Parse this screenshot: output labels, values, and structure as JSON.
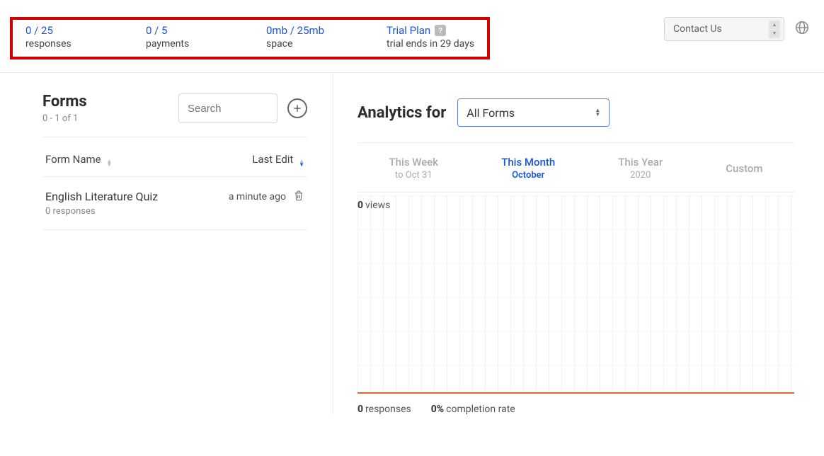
{
  "topbar": {
    "stats": {
      "responses": {
        "value": "0 / 25",
        "label": "responses"
      },
      "payments": {
        "value": "0 / 5",
        "label": "payments"
      },
      "space": {
        "value": "0mb / 25mb",
        "label": "space"
      },
      "plan": {
        "value": "Trial Plan",
        "help": "?",
        "label": "trial ends in 29 days"
      }
    },
    "contact_label": "Contact Us"
  },
  "sidebar": {
    "title": "Forms",
    "range": "0 - 1 of 1",
    "search_placeholder": "Search",
    "col_name": "Form Name",
    "col_edit": "Last Edit",
    "items": [
      {
        "name": "English Literature Quiz",
        "sub": "0 responses",
        "edited": "a minute ago"
      }
    ]
  },
  "analytics": {
    "title": "Analytics for",
    "selector": "All Forms",
    "tabs": {
      "week": {
        "line1": "This Week",
        "line2": "to Oct 31"
      },
      "month": {
        "line1": "This Month",
        "line2": "October"
      },
      "year": {
        "line1": "This Year",
        "line2": "2020"
      },
      "custom": {
        "line1": "Custom"
      }
    },
    "views": {
      "count": "0",
      "label": "views"
    },
    "responses": {
      "count": "0",
      "label": "responses"
    },
    "completion": {
      "count": "0%",
      "label": "completion rate"
    }
  },
  "chart_data": {
    "type": "line",
    "title": "",
    "xlabel": "",
    "ylabel": "views",
    "categories": [],
    "values": [],
    "ylim": [
      0,
      0
    ]
  }
}
